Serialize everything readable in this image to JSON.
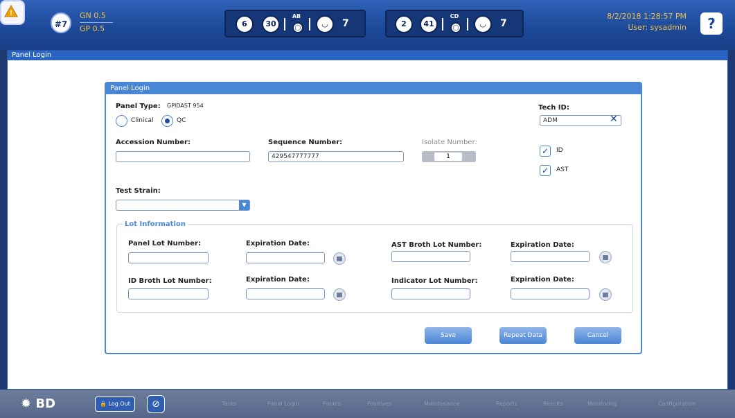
{
  "header": {
    "alert_count": "#7",
    "gn": "GN 0.5",
    "gp": "GP 0.5",
    "instrument1": {
      "a": "6",
      "b": "30",
      "label": "AB",
      "c": "7"
    },
    "instrument2": {
      "a": "2",
      "b": "41",
      "label": "CD",
      "c": "7"
    },
    "datetime": "8/2/2018 1:28:57 PM",
    "user": "User: sysadmin",
    "help": "?"
  },
  "window": {
    "title": "Panel Login"
  },
  "dialog": {
    "title": "Panel Login",
    "panel_type_label": "Panel Type:",
    "panel_type_value": "GPIDAST 954",
    "radio_clinical": "Clinical",
    "radio_qc": "QC",
    "tech_id_label": "Tech ID:",
    "tech_id_value": "ADM",
    "accession_label": "Accession Number:",
    "accession_value": "",
    "sequence_label": "Sequence Number:",
    "sequence_value": "429547777777",
    "isolate_label": "Isolate Number:",
    "isolate_value": "1",
    "check_id": "ID",
    "check_ast": "AST",
    "test_strain_label": "Test Strain:",
    "lot": {
      "title": "Lot Information",
      "panel_lot": "Panel Lot Number:",
      "exp1": "Expiration Date:",
      "ast_broth": "AST Broth Lot Number:",
      "exp2": "Expiration Date:",
      "id_broth": "ID Broth Lot Number:",
      "exp3": "Expiration Date:",
      "indicator": "Indicator Lot Number:",
      "exp4": "Expiration Date:"
    },
    "buttons": {
      "save": "Save",
      "repeat": "Repeat Data",
      "cancel": "Cancel"
    }
  },
  "footer": {
    "brand": "BD",
    "logout": "Log Out",
    "nav": [
      "Tasks",
      "Panel Login",
      "Panels",
      "Positives",
      "Maintenance",
      "Reports",
      "Results",
      "Monitoring",
      "Configuration"
    ]
  }
}
